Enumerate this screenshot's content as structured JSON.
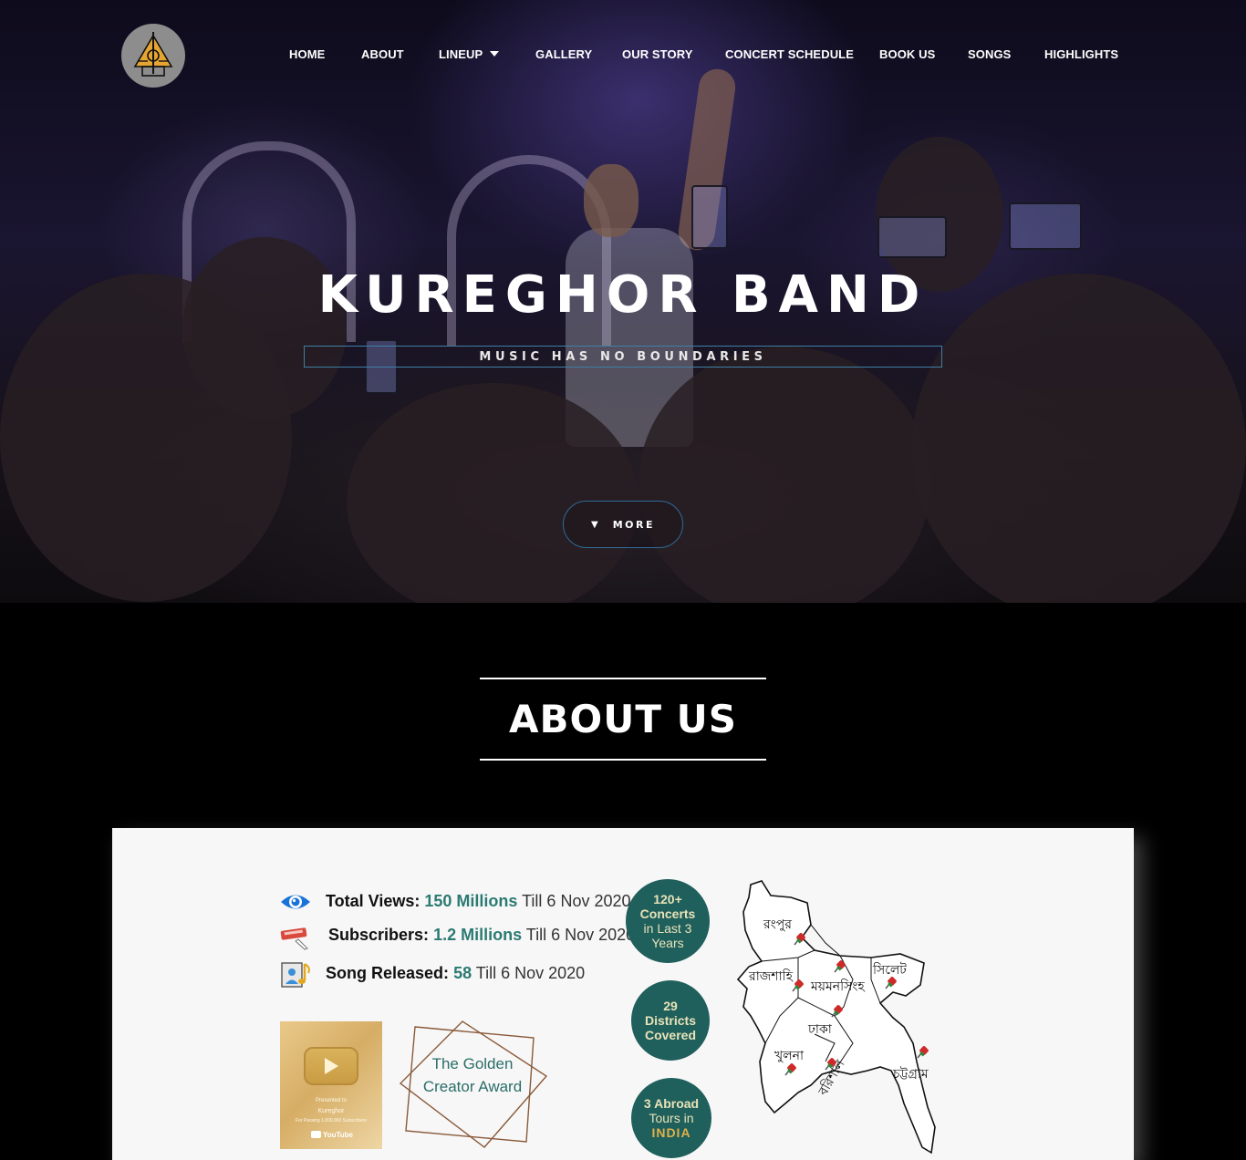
{
  "nav": {
    "items": [
      "HOME",
      "ABOUT",
      "LINEUP",
      "GALLERY",
      "OUR STORY",
      "CONCERT SCHEDULE",
      "BOOK US",
      "SONGS",
      "HIGHLIGHTS"
    ]
  },
  "hero": {
    "title": "KUREGHOR BAND",
    "subtitle": "MUSIC HAS NO BOUNDARIES",
    "more_label": "MORE"
  },
  "about": {
    "title_light": "ABOUT",
    "title_bold": "US"
  },
  "stats": [
    {
      "label": "Total Views:",
      "value": "150 Millions",
      "note": "Till 6 Nov 2020",
      "icon": "eye-icon"
    },
    {
      "label": "Subscribers:",
      "value": "1.2 Millions",
      "note": "Till 6 Nov 2020",
      "icon": "subscribe-icon"
    },
    {
      "label": "Song Released:",
      "value": "58",
      "note": "Till 6 Nov 2020",
      "icon": "music-file-icon"
    }
  ],
  "award": {
    "plaque_line1": "Presented to",
    "plaque_line2": "Kureghor",
    "plaque_line3": "For Passing 1,000,000 Subscribers",
    "plaque_brand": "YouTube",
    "golden_title": "The Golden Creator Award"
  },
  "circles": {
    "concerts": {
      "big": "120+",
      "line2": "Concerts",
      "line3": "in Last 3",
      "line4": "Years"
    },
    "districts": {
      "big": "29",
      "line2": "Districts",
      "line3": "Covered"
    },
    "abroad": {
      "big": "3 Abroad",
      "line2": "Tours in",
      "line3": "INDIA"
    }
  },
  "map": {
    "divisions": [
      "রংপুর",
      "রাজশাহি",
      "ময়মনসিংহ",
      "সিলেট",
      "ঢাকা",
      "খুলনা",
      "বরিশাল",
      "চট্টগ্রাম"
    ]
  },
  "colors": {
    "accent_teal": "#2b7a72",
    "circle_bg": "#1f5f5c",
    "button_border": "#2f6a9a"
  }
}
